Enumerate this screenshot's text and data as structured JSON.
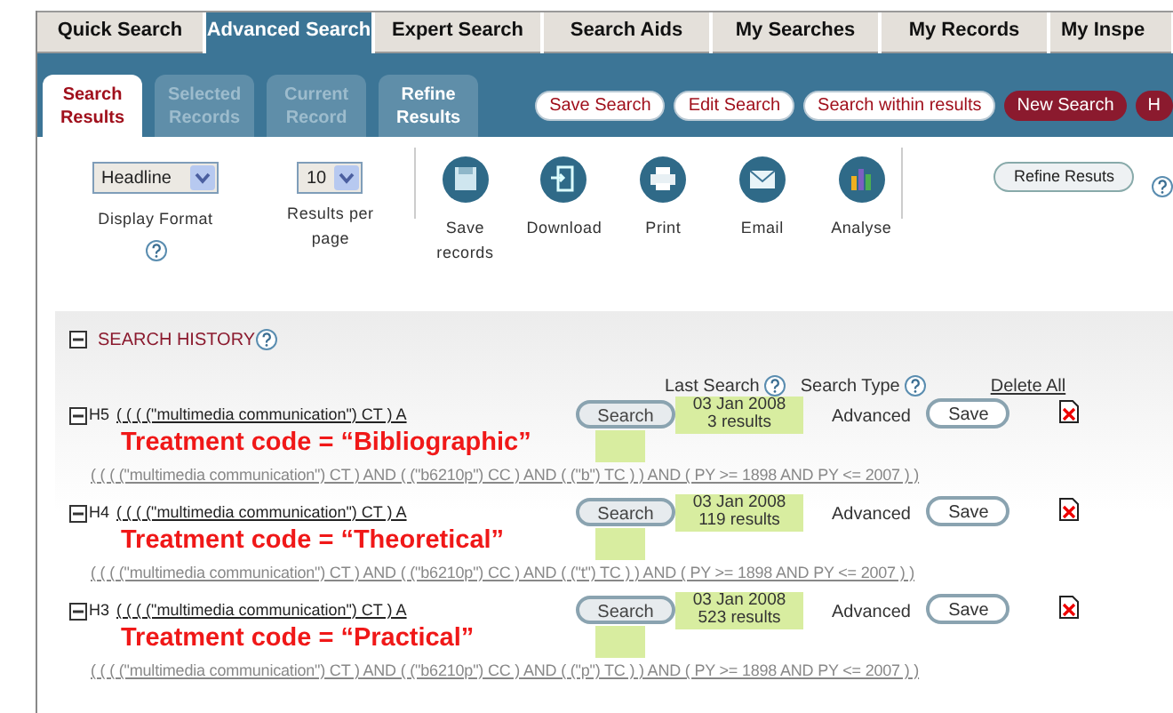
{
  "top_tabs": [
    {
      "label": "Quick Search",
      "selected": false
    },
    {
      "label": "Advanced Search",
      "selected": true
    },
    {
      "label": "Expert Search",
      "selected": false
    },
    {
      "label": "Search Aids",
      "selected": false
    },
    {
      "label": "My Searches",
      "selected": false
    },
    {
      "label": "My Records",
      "selected": false
    },
    {
      "label": "My Inspe",
      "selected": false
    }
  ],
  "result_tabs": [
    {
      "label": "Search Results",
      "selected": true,
      "disabled": false
    },
    {
      "label": "Selected Records",
      "selected": false,
      "disabled": true
    },
    {
      "label": "Current Record",
      "selected": false,
      "disabled": true
    },
    {
      "label": "Refine Results",
      "selected": false,
      "disabled": false
    }
  ],
  "action_buttons": [
    {
      "label": "Save Search",
      "kind": "secondary"
    },
    {
      "label": "Edit Search",
      "kind": "secondary"
    },
    {
      "label": "Search within results",
      "kind": "secondary"
    },
    {
      "label": "New Search",
      "kind": "primary"
    },
    {
      "label": "H",
      "kind": "primary"
    }
  ],
  "toolbar": {
    "display_format": {
      "value": "Headline",
      "label": "Display Format"
    },
    "results_per_page": {
      "value": "10",
      "label": "Results per page"
    },
    "tools": [
      {
        "label": "Save records",
        "kind": "save"
      },
      {
        "label": "Download",
        "kind": "download"
      },
      {
        "label": "Print",
        "kind": "print"
      },
      {
        "label": "Email",
        "kind": "email"
      },
      {
        "label": "Analyse",
        "kind": "analyse"
      }
    ],
    "refine_button": "Refine Resuts"
  },
  "search_history": {
    "title": "SEARCH HISTORY",
    "expanded": true,
    "columns": {
      "last_search": "Last Search",
      "search_type": "Search Type",
      "delete_all": "Delete All"
    },
    "rows": [
      {
        "id": "H5",
        "query_short": "( ( ( (\"multimedia communication\") CT ) A",
        "annotation": "Treatment code = “Bibliographic”",
        "query_full": "( ( ( (\"multimedia communication\") CT ) AND ( (\"b6210p\") CC ) AND ( (\"b\") TC ) ) AND ( PY >= 1898 AND PY <= 2007 ) )",
        "search_button": "Search",
        "date": "03 Jan 2008",
        "results": "3 results",
        "type": "Advanced",
        "save_button": "Save"
      },
      {
        "id": "H4",
        "query_short": "( ( ( (\"multimedia communication\") CT ) A",
        "annotation": "Treatment code = “Theoretical”",
        "query_full": "( ( ( (\"multimedia communication\") CT ) AND ( (\"b6210p\") CC ) AND ( (\"t\") TC ) ) AND ( PY >= 1898 AND PY <= 2007 ) )",
        "search_button": "Search",
        "date": "03 Jan 2008",
        "results": "119 results",
        "type": "Advanced",
        "save_button": "Save"
      },
      {
        "id": "H3",
        "query_short": "( ( ( (\"multimedia communication\") CT ) A",
        "annotation": "Treatment code = “Practical”",
        "query_full": "( ( ( (\"multimedia communication\") CT ) AND ( (\"b6210p\") CC ) AND ( (\"p\") TC ) ) AND ( PY >= 1898 AND PY <= 2007 ) )",
        "search_button": "Search",
        "date": "03 Jan 2008",
        "results": "523 results",
        "type": "Advanced",
        "save_button": "Save"
      }
    ]
  }
}
